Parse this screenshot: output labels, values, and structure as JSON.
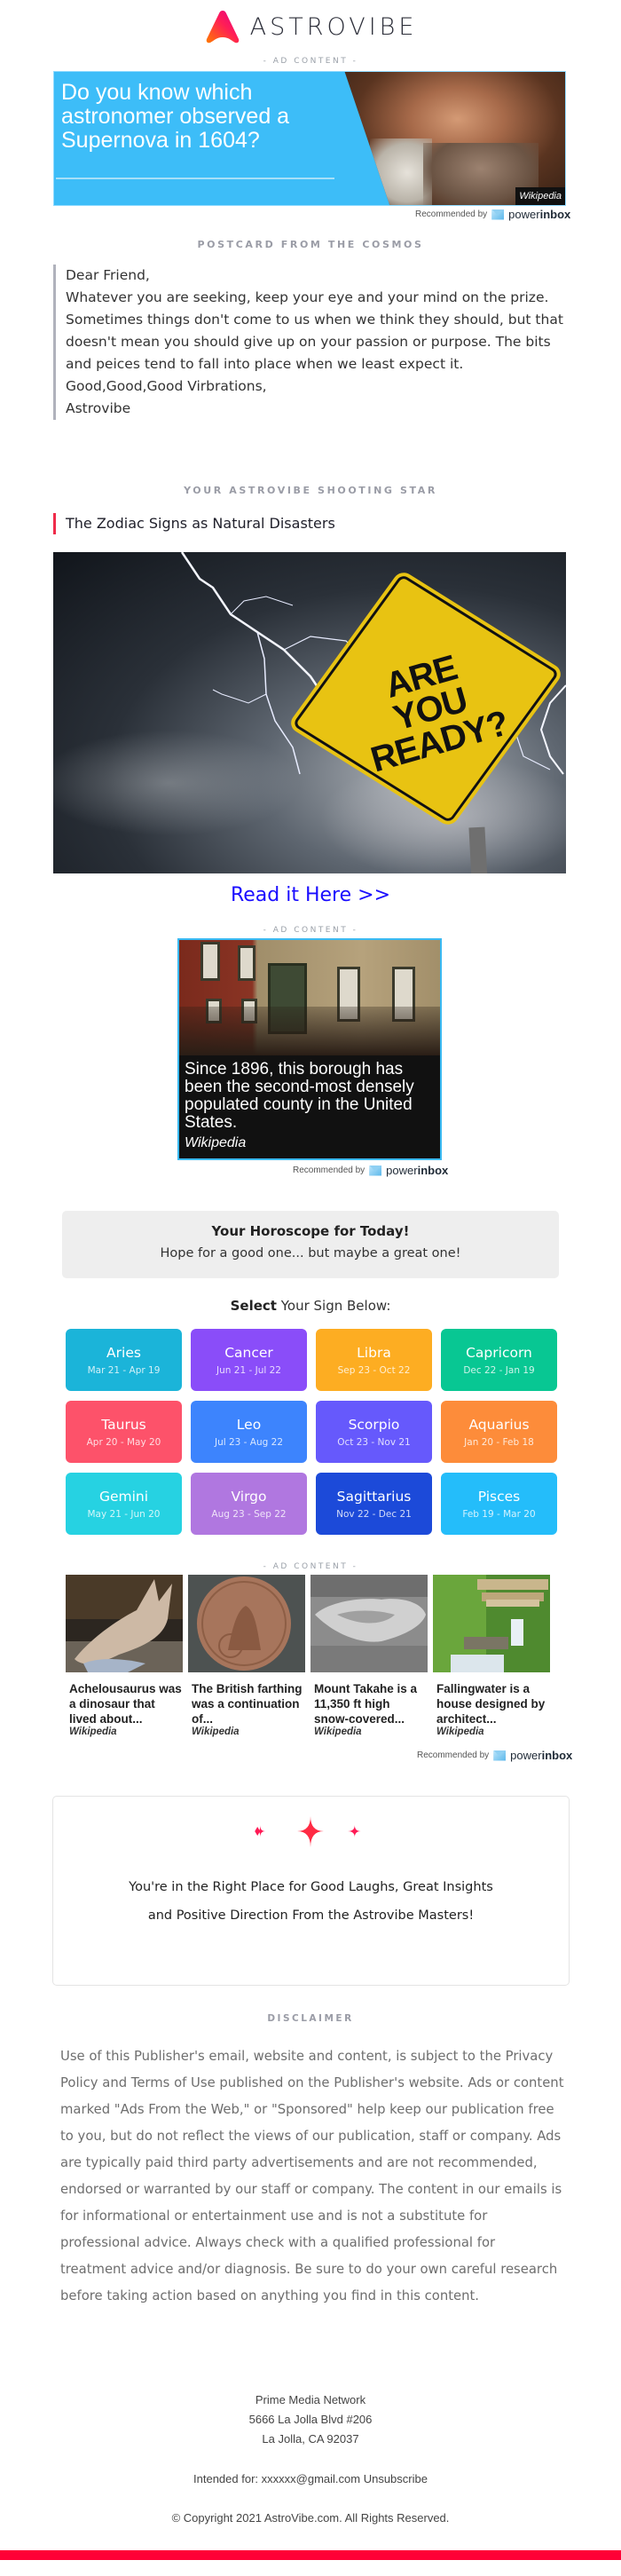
{
  "brand": {
    "name": "ASTROVIBE",
    "accent": "#ef2b4a",
    "bottom_bar_color": "#ff0036"
  },
  "ad_label": "- AD CONTENT -",
  "top_ad": {
    "headline": "Do you know which astronomer observed a Supernova in 1604?",
    "source": "Wikipedia",
    "background": "#3dbdf8"
  },
  "recommended": {
    "label": "Recommended by",
    "brand_prefix": "power",
    "brand_suffix": "inbox"
  },
  "postcard": {
    "section_title": "POSTCARD FROM THE COSMOS",
    "lines": [
      "Dear Friend,",
      "Whatever you are seeking, keep your eye and your mind on the prize. Sometimes things don't come to us when we think they should, but that doesn't mean you should give up on your passion or purpose. The bits and peices tend to fall into place when we least expect it.",
      "Good,Good,Good Virbrations,",
      "Astrovibe"
    ]
  },
  "shooting_star": {
    "section_title": "YOUR ASTROVIBE SHOOTING STAR",
    "article_title": "The Zodiac Signs as Natural Disasters",
    "image_sign_text": [
      "ARE",
      "YOU",
      "READY?"
    ],
    "link_label": "Read it Here >>"
  },
  "mid_ad": {
    "caption": "Since 1896, this borough has been the second-most densely populated county in the United States.",
    "source": "Wikipedia"
  },
  "horoscope": {
    "title": "Your Horoscope for Today!",
    "subtitle": "Hope for a good one... but maybe a great one!",
    "select_bold": "Select",
    "select_rest": " Your Sign Below:",
    "signs": [
      {
        "name": "Aries",
        "dates": "Mar 21 - Apr 19",
        "color": "#1bb4d9"
      },
      {
        "name": "Cancer",
        "dates": "Jun 21 - Jul 22",
        "color": "#8a4df9"
      },
      {
        "name": "Libra",
        "dates": "Sep 23 - Oct 22",
        "color": "#fdad22"
      },
      {
        "name": "Capricorn",
        "dates": "Dec 22 - Jan 19",
        "color": "#08c793"
      },
      {
        "name": "Taurus",
        "dates": "Apr 20 - May 20",
        "color": "#fd526a"
      },
      {
        "name": "Leo",
        "dates": "Jul 23 - Aug 22",
        "color": "#3d84fd"
      },
      {
        "name": "Scorpio",
        "dates": "Oct 23 - Nov 21",
        "color": "#6659fc"
      },
      {
        "name": "Aquarius",
        "dates": "Jan 20 - Feb 18",
        "color": "#fd8c3a"
      },
      {
        "name": "Gemini",
        "dates": "May 21 - Jun 20",
        "color": "#26d2e2"
      },
      {
        "name": "Virgo",
        "dates": "Aug 23 - Sep 22",
        "color": "#b077e0"
      },
      {
        "name": "Sagittarius",
        "dates": "Nov 22 - Dec 21",
        "color": "#1c4ad9"
      },
      {
        "name": "Pisces",
        "dates": "Feb 19 - Mar 20",
        "color": "#24bdfa"
      }
    ]
  },
  "recommendations": [
    {
      "title": "Achelousaurus was a dinosaur that lived about...",
      "source": "Wikipedia"
    },
    {
      "title": "The British farthing was a continuation of...",
      "source": "Wikipedia"
    },
    {
      "title": "Mount Takahe is a 11,350 ft high snow-covered...",
      "source": "Wikipedia"
    },
    {
      "title": "Fallingwater is a house designed by architect...",
      "source": "Wikipedia"
    }
  ],
  "promo": {
    "text": "You're in the Right Place for Good Laughs, Great Insights and Positive Direction From the Astrovibe Masters!"
  },
  "disclaimer": {
    "title": "DISCLAIMER",
    "body": "Use of this Publisher's email, website and content, is subject to the Privacy Policy and Terms of Use published on the Publisher's website. Ads or content marked \"Ads From the Web,\" or \"Sponsored\" help keep our publication free to you, but do not reflect the views of our publication, staff or company. Ads are typically paid third party advertisements and are not recommended, endorsed or warranted by our staff or company. The content in our emails is for informational or entertainment use and is not a substitute for professional advice. Always check with a qualified professional for treatment advice and/or diagnosis. Be sure to do your own careful research before taking action based on anything you find in this content."
  },
  "footer": {
    "company": "Prime Media Network",
    "address1": "5666 La Jolla Blvd #206",
    "address2": "La Jolla, CA 92037",
    "intended_label": "Intended for:",
    "email": "xxxxxx@gmail.com",
    "unsubscribe": "Unsubscribe",
    "copyright": "© Copyright 2021 AstroVibe.com. All Rights Reserved."
  }
}
